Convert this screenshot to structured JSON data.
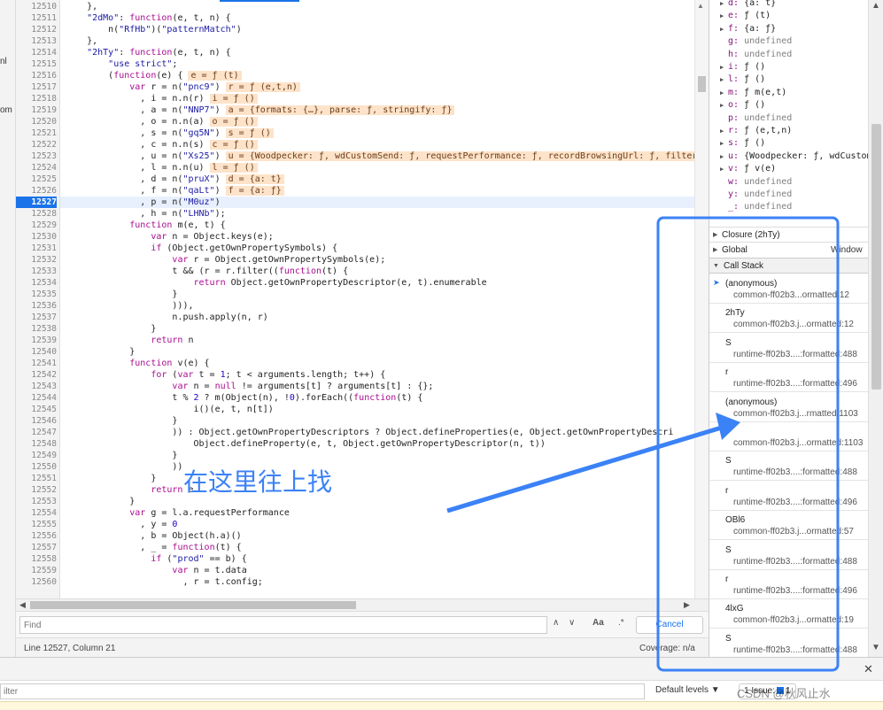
{
  "left_strip": {
    "fragments": [
      "nl",
      "om"
    ]
  },
  "editor": {
    "current_line": 12527,
    "lines": [
      {
        "n": "12510",
        "parts": [
          {
            "t": "    },"
          }
        ]
      },
      {
        "n": "12511",
        "parts": [
          {
            "t": "    "
          },
          {
            "t": "\"2dMo\"",
            "c": "str"
          },
          {
            "t": ": "
          },
          {
            "t": "function",
            "c": "kw"
          },
          {
            "t": "(e, t, n) {"
          }
        ]
      },
      {
        "n": "12512",
        "parts": [
          {
            "t": "        n("
          },
          {
            "t": "\"RfHb\"",
            "c": "str"
          },
          {
            "t": ")("
          },
          {
            "t": "\"patternMatch\"",
            "c": "str"
          },
          {
            "t": ")"
          }
        ]
      },
      {
        "n": "12513",
        "parts": [
          {
            "t": "    },"
          }
        ]
      },
      {
        "n": "12514",
        "parts": [
          {
            "t": "    "
          },
          {
            "t": "\"2hTy\"",
            "c": "str"
          },
          {
            "t": ": "
          },
          {
            "t": "function",
            "c": "kw"
          },
          {
            "t": "(e, t, n) {"
          }
        ]
      },
      {
        "n": "12515",
        "parts": [
          {
            "t": "        "
          },
          {
            "t": "\"use strict\"",
            "c": "str"
          },
          {
            "t": ";"
          }
        ]
      },
      {
        "n": "12516",
        "parts": [
          {
            "t": "        ("
          },
          {
            "t": "function",
            "c": "kw"
          },
          {
            "t": "(e) {"
          },
          {
            "t": "e = ƒ (t)",
            "c": "iv"
          }
        ]
      },
      {
        "n": "12517",
        "parts": [
          {
            "t": "            "
          },
          {
            "t": "var",
            "c": "kw"
          },
          {
            "t": " r = n("
          },
          {
            "t": "\"pnc9\"",
            "c": "str"
          },
          {
            "t": ")"
          },
          {
            "t": "r = ƒ (e,t,n)",
            "c": "iv"
          }
        ]
      },
      {
        "n": "12518",
        "parts": [
          {
            "t": "              , i = n.n(r)"
          },
          {
            "t": "i = ƒ ()",
            "c": "iv"
          }
        ]
      },
      {
        "n": "12519",
        "parts": [
          {
            "t": "              , a = n("
          },
          {
            "t": "\"NNP7\"",
            "c": "str"
          },
          {
            "t": ")"
          },
          {
            "t": "a = {formats: {…}, parse: ƒ, stringify: ƒ}",
            "c": "iv"
          }
        ]
      },
      {
        "n": "12520",
        "parts": [
          {
            "t": "              , o = n.n(a)"
          },
          {
            "t": "o = ƒ ()",
            "c": "iv"
          }
        ]
      },
      {
        "n": "12521",
        "parts": [
          {
            "t": "              , s = n("
          },
          {
            "t": "\"gq5N\"",
            "c": "str"
          },
          {
            "t": ")"
          },
          {
            "t": "s = ƒ ()",
            "c": "iv"
          }
        ]
      },
      {
        "n": "12522",
        "parts": [
          {
            "t": "              , c = n.n(s)"
          },
          {
            "t": "c = ƒ ()",
            "c": "iv"
          }
        ]
      },
      {
        "n": "12523",
        "parts": [
          {
            "t": "              , u = n("
          },
          {
            "t": "\"Xs25\"",
            "c": "str"
          },
          {
            "t": ")"
          },
          {
            "t": "u = {Woodpecker: ƒ, wdCustomSend: ƒ, requestPerformance: ƒ, recordBrowsingUrl: ƒ, filterT",
            "c": "iv"
          }
        ]
      },
      {
        "n": "12524",
        "parts": [
          {
            "t": "              , l = n.n(u)"
          },
          {
            "t": "l = ƒ ()",
            "c": "iv"
          }
        ]
      },
      {
        "n": "12525",
        "parts": [
          {
            "t": "              , d = n("
          },
          {
            "t": "\"pruX\"",
            "c": "str"
          },
          {
            "t": ")"
          },
          {
            "t": "d = {a: t}",
            "c": "iv"
          }
        ]
      },
      {
        "n": "12526",
        "parts": [
          {
            "t": "              , f = n("
          },
          {
            "t": "\"qaLt\"",
            "c": "str"
          },
          {
            "t": ")"
          },
          {
            "t": "f = {a: ƒ}",
            "c": "iv"
          }
        ]
      },
      {
        "n": "12527",
        "parts": [
          {
            "t": "              , p = n("
          },
          {
            "t": "\"M0uz\"",
            "c": "str"
          },
          {
            "t": ")"
          }
        ]
      },
      {
        "n": "12528",
        "parts": [
          {
            "t": "              , h = n("
          },
          {
            "t": "\"LHNb\"",
            "c": "str"
          },
          {
            "t": ");"
          }
        ]
      },
      {
        "n": "12529",
        "parts": [
          {
            "t": "            "
          },
          {
            "t": "function",
            "c": "kw"
          },
          {
            "t": " m(e, t) {"
          }
        ]
      },
      {
        "n": "12530",
        "parts": [
          {
            "t": "                "
          },
          {
            "t": "var",
            "c": "kw"
          },
          {
            "t": " n = Object.keys(e);"
          }
        ]
      },
      {
        "n": "12531",
        "parts": [
          {
            "t": "                "
          },
          {
            "t": "if",
            "c": "kw"
          },
          {
            "t": " (Object.getOwnPropertySymbols) {"
          }
        ]
      },
      {
        "n": "12532",
        "parts": [
          {
            "t": "                    "
          },
          {
            "t": "var",
            "c": "kw"
          },
          {
            "t": " r = Object.getOwnPropertySymbols(e);"
          }
        ]
      },
      {
        "n": "12533",
        "parts": [
          {
            "t": "                    t && (r = r.filter(("
          },
          {
            "t": "function",
            "c": "kw"
          },
          {
            "t": "(t) {"
          }
        ]
      },
      {
        "n": "12534",
        "parts": [
          {
            "t": "                        "
          },
          {
            "t": "return",
            "c": "kw"
          },
          {
            "t": " Object.getOwnPropertyDescriptor(e, t).enumerable"
          }
        ]
      },
      {
        "n": "12535",
        "parts": [
          {
            "t": "                    }"
          }
        ]
      },
      {
        "n": "12536",
        "parts": [
          {
            "t": "                    ))),"
          }
        ]
      },
      {
        "n": "12537",
        "parts": [
          {
            "t": "                    n.push.apply(n, r)"
          }
        ]
      },
      {
        "n": "12538",
        "parts": [
          {
            "t": "                }"
          }
        ]
      },
      {
        "n": "12539",
        "parts": [
          {
            "t": "                "
          },
          {
            "t": "return",
            "c": "kw"
          },
          {
            "t": " n"
          }
        ]
      },
      {
        "n": "12540",
        "parts": [
          {
            "t": "            }"
          }
        ]
      },
      {
        "n": "12541",
        "parts": [
          {
            "t": "            "
          },
          {
            "t": "function",
            "c": "kw"
          },
          {
            "t": " v(e) {"
          }
        ]
      },
      {
        "n": "12542",
        "parts": [
          {
            "t": "                "
          },
          {
            "t": "for",
            "c": "kw"
          },
          {
            "t": " ("
          },
          {
            "t": "var",
            "c": "kw"
          },
          {
            "t": " t = "
          },
          {
            "t": "1",
            "c": "num"
          },
          {
            "t": "; t < arguments.length; t++) {"
          }
        ]
      },
      {
        "n": "12543",
        "parts": [
          {
            "t": "                    "
          },
          {
            "t": "var",
            "c": "kw"
          },
          {
            "t": " n = "
          },
          {
            "t": "null",
            "c": "kw"
          },
          {
            "t": " != arguments[t] ? arguments[t] : {};"
          }
        ]
      },
      {
        "n": "12544",
        "parts": [
          {
            "t": "                    t % "
          },
          {
            "t": "2",
            "c": "num"
          },
          {
            "t": " ? m(Object(n), !"
          },
          {
            "t": "0",
            "c": "num"
          },
          {
            "t": ").forEach(("
          },
          {
            "t": "function",
            "c": "kw"
          },
          {
            "t": "(t) {"
          }
        ]
      },
      {
        "n": "12545",
        "parts": [
          {
            "t": "                        i()(e, t, n[t])"
          }
        ]
      },
      {
        "n": "12546",
        "parts": [
          {
            "t": "                    }"
          }
        ]
      },
      {
        "n": "12547",
        "parts": [
          {
            "t": "                    )) : Object.getOwnPropertyDescriptors ? Object.defineProperties(e, Object.getOwnPropertyDescri"
          }
        ]
      },
      {
        "n": "12548",
        "parts": [
          {
            "t": "                        Object.defineProperty(e, t, Object.getOwnPropertyDescriptor(n, t))"
          }
        ]
      },
      {
        "n": "12549",
        "parts": [
          {
            "t": "                    }"
          }
        ]
      },
      {
        "n": "12550",
        "parts": [
          {
            "t": "                    ))"
          }
        ]
      },
      {
        "n": "12551",
        "parts": [
          {
            "t": "                }"
          }
        ]
      },
      {
        "n": "12552",
        "parts": [
          {
            "t": "                "
          },
          {
            "t": "return",
            "c": "kw"
          },
          {
            "t": " e"
          }
        ]
      },
      {
        "n": "12553",
        "parts": [
          {
            "t": "            }"
          }
        ]
      },
      {
        "n": "12554",
        "parts": [
          {
            "t": "            "
          },
          {
            "t": "var",
            "c": "kw"
          },
          {
            "t": " g = l.a.requestPerformance"
          }
        ]
      },
      {
        "n": "12555",
        "parts": [
          {
            "t": "              , y = "
          },
          {
            "t": "0",
            "c": "num"
          }
        ]
      },
      {
        "n": "12556",
        "parts": [
          {
            "t": "              , b = Object(h.a)()"
          }
        ]
      },
      {
        "n": "12557",
        "parts": [
          {
            "t": "              , _ = "
          },
          {
            "t": "function",
            "c": "kw"
          },
          {
            "t": "(t) {"
          }
        ]
      },
      {
        "n": "12558",
        "parts": [
          {
            "t": "                "
          },
          {
            "t": "if",
            "c": "kw"
          },
          {
            "t": " ("
          },
          {
            "t": "\"prod\"",
            "c": "str"
          },
          {
            "t": " == b) {"
          }
        ]
      },
      {
        "n": "12559",
        "parts": [
          {
            "t": "                    "
          },
          {
            "t": "var",
            "c": "kw"
          },
          {
            "t": " n = t.data"
          }
        ]
      },
      {
        "n": "12560",
        "parts": [
          {
            "t": "                      , r = t.config;"
          }
        ]
      }
    ]
  },
  "find": {
    "placeholder": "Find",
    "aa": "Aa",
    "regex": ".*",
    "cancel": "Cancel"
  },
  "status": {
    "position": "Line 12527, Column 21",
    "coverage": "Coverage: n/a"
  },
  "scope": {
    "vars": [
      {
        "name": "d",
        "value": "{a: t}",
        "exp": true
      },
      {
        "name": "e",
        "value": "ƒ (t)",
        "exp": true
      },
      {
        "name": "f",
        "value": "{a: ƒ}",
        "exp": true
      },
      {
        "name": "g",
        "value": "undefined",
        "exp": false
      },
      {
        "name": "h",
        "value": "undefined",
        "exp": false
      },
      {
        "name": "i",
        "value": "ƒ ()",
        "exp": true
      },
      {
        "name": "l",
        "value": "ƒ ()",
        "exp": true
      },
      {
        "name": "m",
        "value": "ƒ m(e,t)",
        "exp": true
      },
      {
        "name": "o",
        "value": "ƒ ()",
        "exp": true
      },
      {
        "name": "p",
        "value": "undefined",
        "exp": false
      },
      {
        "name": "r",
        "value": "ƒ (e,t,n)",
        "exp": true
      },
      {
        "name": "s",
        "value": "ƒ ()",
        "exp": true
      },
      {
        "name": "u",
        "value": "{Woodpecker: ƒ, wdCustom",
        "exp": true
      },
      {
        "name": "v",
        "value": "ƒ v(e)",
        "exp": true
      },
      {
        "name": "w",
        "value": "undefined",
        "exp": false
      },
      {
        "name": "y",
        "value": "undefined",
        "exp": false
      },
      {
        "name": "_",
        "value": "undefined",
        "exp": false
      }
    ],
    "closure": "Closure (2hTy)",
    "global": "Global",
    "global_value": "Window"
  },
  "callstack": {
    "title": "Call Stack",
    "frames": [
      {
        "fn": "(anonymous)",
        "loc": "common-ff02b3...ormatted:12",
        "current": true
      },
      {
        "fn": "2hTy",
        "loc": "common-ff02b3.j...ormatted:12"
      },
      {
        "fn": "S",
        "loc": "runtime-ff02b3....:formatted:488"
      },
      {
        "fn": "r",
        "loc": "runtime-ff02b3....:formatted:496"
      },
      {
        "fn": "(anonymous)",
        "loc": "common-ff02b3.j...rmatted:1103"
      },
      {
        "fn": "l",
        "loc": "common-ff02b3.j...ormatted:1103"
      },
      {
        "fn": "S",
        "loc": "runtime-ff02b3....:formatted:488"
      },
      {
        "fn": "r",
        "loc": "runtime-ff02b3....:formatted:496"
      },
      {
        "fn": "OBl6",
        "loc": "common-ff02b3.j...ormatted:57"
      },
      {
        "fn": "S",
        "loc": "runtime-ff02b3....:formatted:488"
      },
      {
        "fn": "r",
        "loc": "runtime-ff02b3....:formatted:496"
      },
      {
        "fn": "4lxG",
        "loc": "common-ff02b3.j...ormatted:19"
      },
      {
        "fn": "S",
        "loc": "runtime-ff02b3....:formatted:488"
      }
    ]
  },
  "console": {
    "filter_placeholder": "ilter",
    "levels": "Default levels ▼",
    "issues_prefix": "1 Issue:",
    "issues_count": "1"
  },
  "annotation": "在这里往上找",
  "watermark": "CSDN @秋风止水",
  "colors": {
    "accent": "#1a73e8",
    "annotation": "#3b82f6"
  }
}
